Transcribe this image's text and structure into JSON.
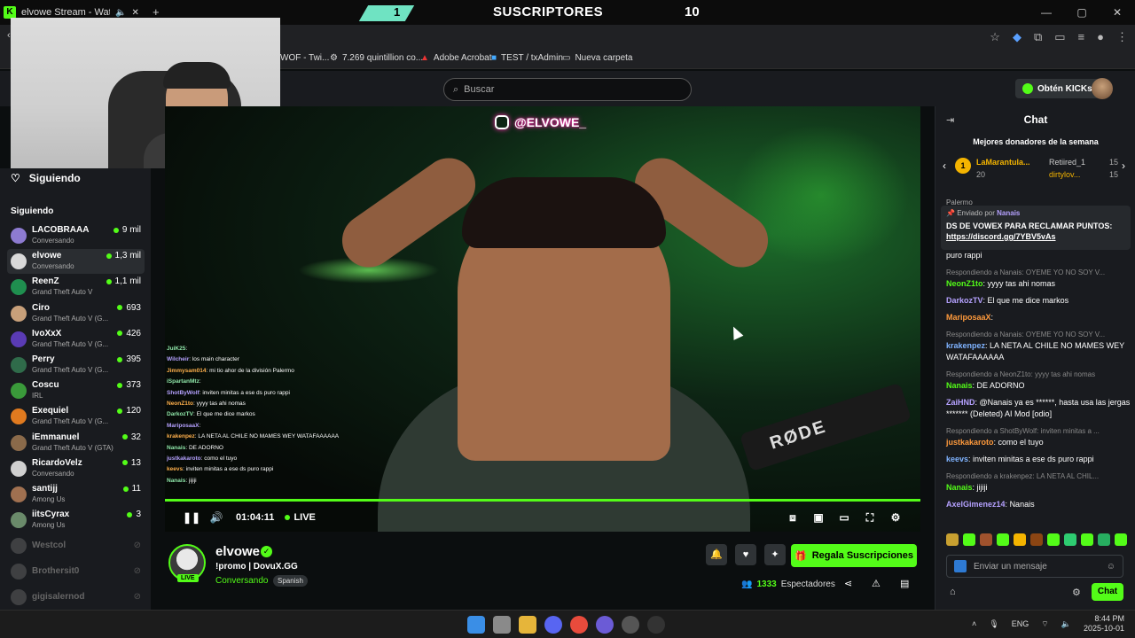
{
  "overlay_banner": {
    "title": "SUSCRIPTORES",
    "count": "10",
    "left_digit": "1"
  },
  "browser": {
    "tab_title": "elvowe Stream - Watch Live",
    "window_controls": [
      "—",
      "▢",
      "✕"
    ],
    "bookmarks": [
      {
        "label": "WOF - Twi...",
        "icon": "bookmark-icon"
      },
      {
        "label": "7.269 quintillion co...",
        "icon": "bookmark-icon"
      },
      {
        "label": "Adobe Acrobat",
        "icon": "acrobat-icon"
      },
      {
        "label": "TEST / txAdmin",
        "icon": "txadmin-icon"
      },
      {
        "label": "Nueva carpeta",
        "icon": "folder-icon"
      }
    ]
  },
  "kick_top": {
    "search_placeholder": "Buscar",
    "obten_label": "Obtén KICKs"
  },
  "sidebar": {
    "top_label": "Siguiendo",
    "section_label": "Siguiendo",
    "channels": [
      {
        "name": "LACOBRAAA",
        "category": "Conversando",
        "viewers": "9 mil",
        "color": "#8d7bd1"
      },
      {
        "name": "elvowe",
        "category": "Conversando",
        "viewers": "1,3 mil",
        "color": "#d9d9d9"
      },
      {
        "name": "ReenZ",
        "category": "Grand Theft Auto V",
        "viewers": "1,1 mil",
        "color": "#1f8f4f"
      },
      {
        "name": "Ciro",
        "category": "Grand Theft Auto V (G...",
        "viewers": "693",
        "color": "#c8a07a"
      },
      {
        "name": "IvoXxX",
        "category": "Grand Theft Auto V (G...",
        "viewers": "426",
        "color": "#5a3bb5"
      },
      {
        "name": "Perry",
        "category": "Grand Theft Auto V (G...",
        "viewers": "395",
        "color": "#2f6b4a"
      },
      {
        "name": "Coscu",
        "category": "IRL",
        "viewers": "373",
        "color": "#3a9a3a"
      },
      {
        "name": "Exequiel",
        "category": "Grand Theft Auto V (G...",
        "viewers": "120",
        "color": "#e07a1f"
      },
      {
        "name": "iEmmanuel",
        "category": "Grand Theft Auto V (GTA)",
        "viewers": "32",
        "color": "#8a6a4a"
      },
      {
        "name": "RicardoVelz",
        "category": "Conversando",
        "viewers": "13",
        "color": "#d0d0d0"
      },
      {
        "name": "santijj",
        "category": "Among Us",
        "viewers": "11",
        "color": "#a07050"
      },
      {
        "name": "iitsCyrax",
        "category": "Among Us",
        "viewers": "3",
        "color": "#6a8a6a"
      }
    ],
    "offline": [
      "Westcol",
      "Brothersit0",
      "gigisalernod"
    ]
  },
  "video": {
    "instagram_handle": "@ELVOWE_",
    "time": "01:04:11",
    "live_label": "LIVE",
    "mic_brand": "RØDE",
    "overlay_chat": [
      {
        "user": "JuiK25",
        "text": ""
      },
      {
        "user": "Wilcheir",
        "text": "los main character"
      },
      {
        "user": "Jimmysam014",
        "text": "mi tio ahor de la división Palermo"
      },
      {
        "user": "iSpartanMtz",
        "text": ""
      },
      {
        "user": "ShotByWolf",
        "text": "inviten minitas a ese ds puro rappi"
      },
      {
        "user": "NeonZ1to",
        "text": "yyyy tas ahi nomas"
      },
      {
        "user": "DarkozTV",
        "text": "El que me dice markos"
      },
      {
        "user": "MariposaaX",
        "text": ""
      },
      {
        "user": "krakenpez",
        "text": "LA NETA AL CHILE NO MAMES WEY WATAFAAAAAA"
      },
      {
        "user": "Nanais",
        "text": "DE ADORNO"
      },
      {
        "user": "justkakaroto",
        "text": "como el tuyo"
      },
      {
        "user": "keevs",
        "text": "inviten minitas a ese ds puro rappi"
      },
      {
        "user": "Nanais",
        "text": "jijiji"
      }
    ]
  },
  "channel": {
    "name": "elvowe",
    "live_badge": "LIVE",
    "title": "!promo | DovuX.GG",
    "category": "Conversando",
    "language": "Spanish",
    "gift_label": "Regala Suscripciones",
    "viewer_count": "1333",
    "viewer_label": "Espectadores"
  },
  "chat": {
    "title": "Chat",
    "donors_heading": "Mejores donadores de la semana",
    "donor1_name": "LaMarantula...",
    "donor1_amount": "20",
    "donor1_rank": "1",
    "donor2_name": "Retiired_1",
    "donor2_amount": "15",
    "donor3_name": "dirtylov...",
    "donor3_amount": "15",
    "partial_text": "Palermo",
    "pinned_by_label": "Enviado por",
    "pinned_user": "Nanais",
    "pinned_text": "DS DE VOWEX PARA RECLAMAR PUNTOS:",
    "pinned_link": "https://discord.gg/7YBV5vAs",
    "messages": [
      {
        "reply": "",
        "user": "",
        "text": "puro rappi"
      },
      {
        "reply": "Respondiendo a Nanais: OYEME YO NO SOY V...",
        "user": "NeonZ1to",
        "text": "yyyy tas ahi nomas"
      },
      {
        "reply": "",
        "user": "DarkozTV",
        "text": "El que me dice markos"
      },
      {
        "reply": "",
        "user": "MariposaaX",
        "text": ""
      },
      {
        "reply": "Respondiendo a Nanais: OYEME YO NO SOY V...",
        "user": "krakenpez",
        "text": "LA NETA AL CHILE NO MAMES WEY WATAFAAAAAA"
      },
      {
        "reply": "Respondiendo a NeonZ1to: yyyy tas ahi nomas",
        "user": "Nanais",
        "text": "DE ADORNO"
      },
      {
        "reply": "",
        "user": "ZaiHND",
        "text": "@Nanais ya es ******, hasta usa las jergas ******* (Deleted) AI Mod [odio]"
      },
      {
        "reply": "Respondiendo a ShotByWolf: inviten minitas a ...",
        "user": "justkakaroto",
        "text": "como el tuyo"
      },
      {
        "reply": "",
        "user": "keevs",
        "text": "inviten minitas a ese ds puro rappi"
      },
      {
        "reply": "Respondiendo a krakenpez: LA NETA AL CHIL...",
        "user": "Nanais",
        "text": "jijiji"
      },
      {
        "reply": "",
        "user": "AxelGimenez14",
        "text": "Nanais"
      }
    ],
    "input_placeholder": "Enviar un mensaje",
    "send_label": "Chat"
  },
  "taskbar": {
    "lang": "ENG",
    "time": "8:44 PM",
    "date": "2025-10-01"
  }
}
